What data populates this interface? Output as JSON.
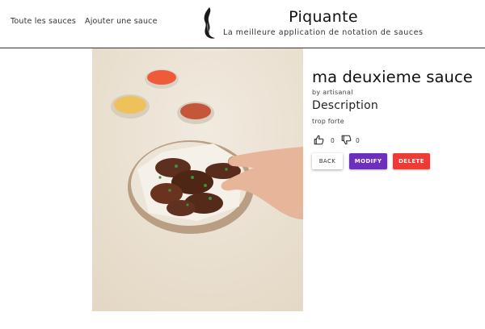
{
  "nav": {
    "links": [
      {
        "label": "Toute les sauces"
      },
      {
        "label": "Ajouter une sauce"
      }
    ]
  },
  "brand": {
    "title": "Piquante",
    "subtitle": "La meilleure application de notation de sauces"
  },
  "sauce": {
    "name": "ma deuxieme sauce",
    "by_line": "by artisanal",
    "description_heading": "Description",
    "description": "trop forte",
    "likes": "0",
    "dislikes": "0"
  },
  "actions": {
    "back_label": "BACK",
    "modify_label": "MODIFY",
    "delete_label": "DELETE"
  },
  "icons": {
    "logo": "flame-logo-icon",
    "like": "thumbs-up-icon",
    "dislike": "thumbs-down-icon"
  },
  "colors": {
    "modify": "#6f2fbd",
    "delete": "#ef3b36",
    "header_border": "#333333"
  }
}
